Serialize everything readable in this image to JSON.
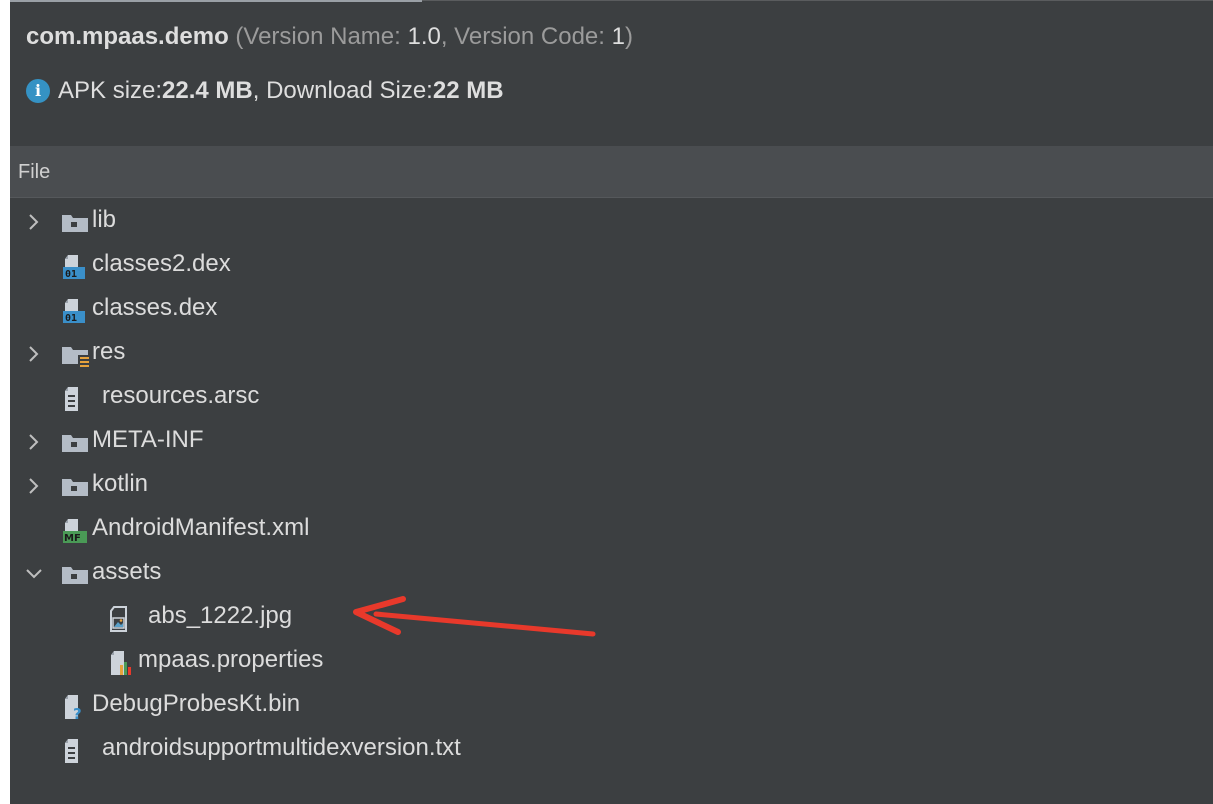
{
  "header": {
    "package": "com.mpaas.demo",
    "version_open": " (Version Name: ",
    "version_name": "1.0",
    "version_mid": ", Version Code: ",
    "version_code": "1",
    "version_close": ")",
    "apk_prefix": "APK size: ",
    "apk_size": "22.4 MB",
    "download_prefix": ", Download Size: ",
    "download_size": "22 MB"
  },
  "column_header": "File",
  "tree": [
    {
      "label": "lib",
      "icon": "folder-icon",
      "expandable": true,
      "expanded": false,
      "depth": 0
    },
    {
      "label": "classes2.dex",
      "icon": "dex-file-icon",
      "expandable": false,
      "depth": 0
    },
    {
      "label": "classes.dex",
      "icon": "dex-file-icon",
      "expandable": false,
      "depth": 0
    },
    {
      "label": "res",
      "icon": "resource-folder-icon",
      "expandable": true,
      "expanded": false,
      "depth": 0
    },
    {
      "label": "resources.arsc",
      "icon": "text-file-icon",
      "expandable": false,
      "depth": 0
    },
    {
      "label": "META-INF",
      "icon": "folder-icon",
      "expandable": true,
      "expanded": false,
      "depth": 0
    },
    {
      "label": "kotlin",
      "icon": "folder-icon",
      "expandable": true,
      "expanded": false,
      "depth": 0
    },
    {
      "label": "AndroidManifest.xml",
      "icon": "manifest-file-icon",
      "expandable": false,
      "depth": 0
    },
    {
      "label": "assets",
      "icon": "folder-icon",
      "expandable": true,
      "expanded": true,
      "depth": 0
    },
    {
      "label": "abs_1222.jpg",
      "icon": "image-file-icon",
      "expandable": false,
      "depth": 1
    },
    {
      "label": "mpaas.properties",
      "icon": "properties-file-icon",
      "expandable": false,
      "depth": 1
    },
    {
      "label": "DebugProbesKt.bin",
      "icon": "unknown-file-icon",
      "expandable": false,
      "depth": 0
    },
    {
      "label": "androidsupportmultidexversion.txt",
      "icon": "text-file-icon",
      "expandable": false,
      "depth": 0
    }
  ],
  "annotation": {
    "icon": "red-arrow-annotation",
    "color": "#e8392b"
  },
  "colors": {
    "background": "#3c3f41",
    "header_bar": "#4a4d50",
    "info_blue": "#3592c4",
    "folder_gray": "#b4bcc6",
    "dex_blue": "#3a8fc9",
    "manifest_green": "#4a9a56"
  }
}
